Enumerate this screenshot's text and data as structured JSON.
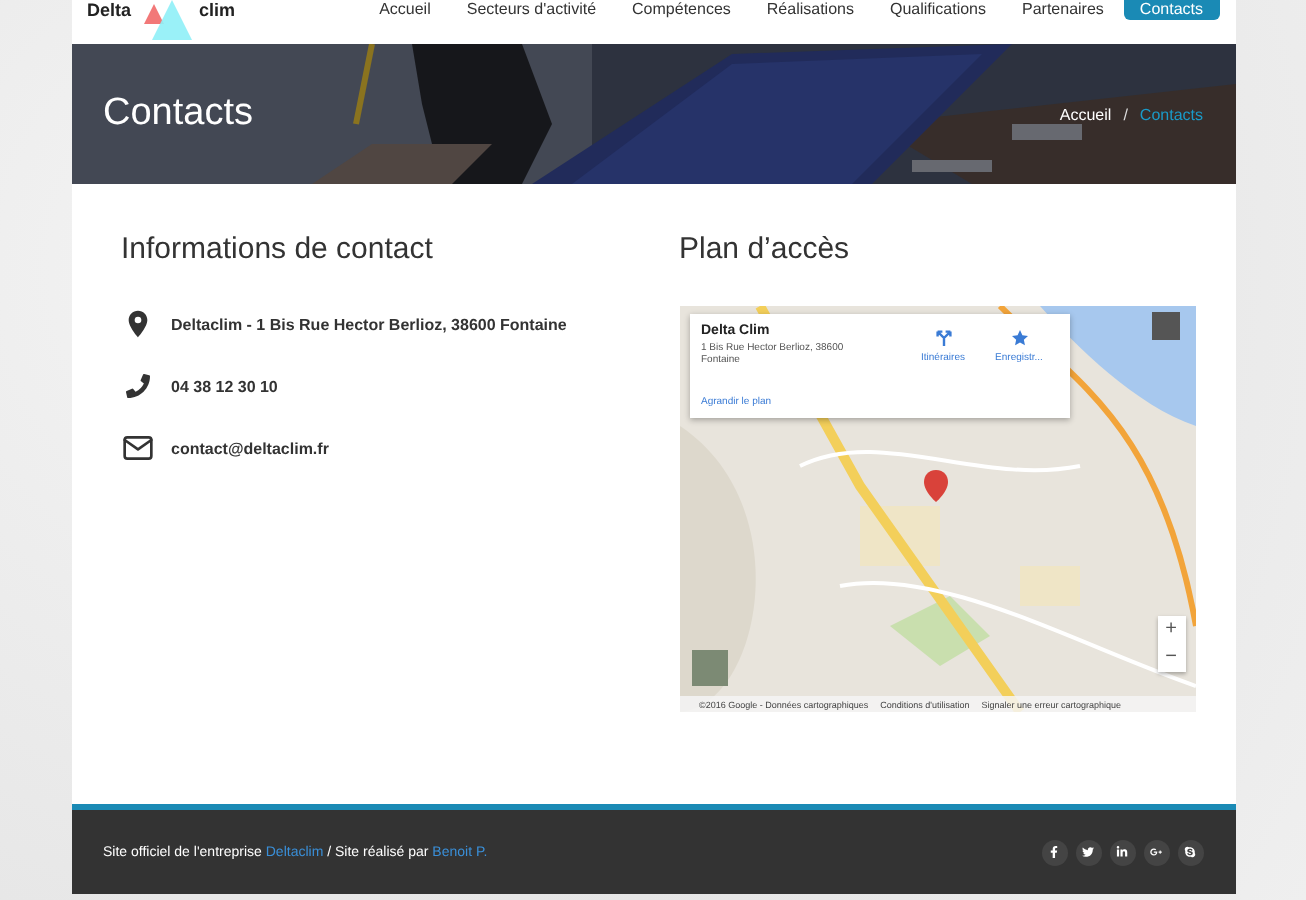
{
  "header": {
    "logo": [
      "Delta",
      "clim"
    ],
    "nav": [
      {
        "label": "Accueil",
        "selected": false
      },
      {
        "label": "Secteurs d'activité",
        "selected": false
      },
      {
        "label": "Compétences",
        "selected": false
      },
      {
        "label": "Réalisations",
        "selected": false
      },
      {
        "label": "Qualifications",
        "selected": false
      },
      {
        "label": "Partenaires",
        "selected": false
      },
      {
        "label": "Contacts",
        "selected": true
      }
    ]
  },
  "banner": {
    "title": "Contacts",
    "breadcrumb": [
      {
        "label": "Accueil",
        "current": false
      },
      {
        "label": "Contacts",
        "current": true
      }
    ],
    "separator": "/"
  },
  "contact": {
    "heading": "Informations de contact",
    "items": [
      {
        "kind": "address",
        "text": "Deltaclim - 1 Bis Rue Hector Berlioz, 38600 Fontaine"
      },
      {
        "kind": "phone",
        "text": "04 38 12 30 10"
      },
      {
        "kind": "email",
        "text": "contact@deltaclim.fr"
      }
    ]
  },
  "map": {
    "heading": "Plan d’accès",
    "card": {
      "name": "Delta Clim",
      "address": "1 Bis Rue Hector Berlioz, 38600 Fontaine",
      "link": "Agrandir le plan",
      "actions": [
        {
          "kind": "directions",
          "label": "Itinéraires"
        },
        {
          "kind": "save",
          "label": "Enregistr..."
        }
      ]
    },
    "zoom": [
      "+",
      "−"
    ],
    "attribution": [
      "©2016 Google - Données cartographiques",
      "Conditions d'utilisation",
      "Signaler une erreur cartographique"
    ]
  },
  "footer": {
    "text_before": "Site officiel de l'entreprise",
    "link1": "Deltaclim",
    "text_middle": "/ Site réalisé par",
    "link2": "Benoit P.",
    "social": [
      {
        "kind": "facebook"
      },
      {
        "kind": "twitter"
      },
      {
        "kind": "linkedin"
      },
      {
        "kind": "google-plus"
      },
      {
        "kind": "skype"
      }
    ]
  }
}
